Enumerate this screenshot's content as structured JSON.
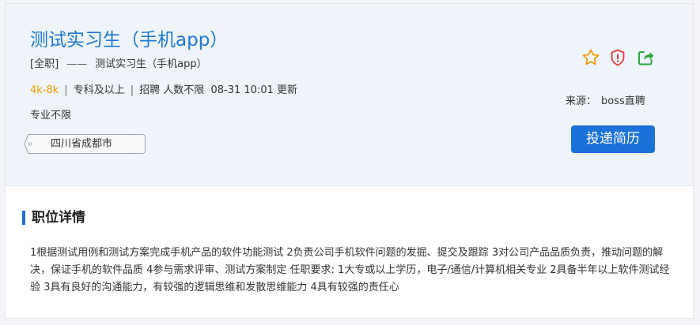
{
  "job": {
    "title": "测试实习生（手机app）",
    "type_tag": "[全职]",
    "separator": "——",
    "subtitle_name": "测试实习生（手机app）",
    "salary": "4k-8k",
    "education": "专科及以上",
    "recruit": "招聘 人数不限",
    "updated": "08-31 10:01 更新",
    "major": "专业不限",
    "location": "四川省成都市",
    "pipe": "|"
  },
  "source": {
    "label": "来源：",
    "value": "boss直聘"
  },
  "actions": {
    "apply_label": "投递简历",
    "icons": [
      "star-icon",
      "shield-icon",
      "share-icon"
    ]
  },
  "detail": {
    "section_title": "职位详情",
    "description": "1根据测试用例和测试方案完成手机产品的软件功能测试 2负责公司手机软件问题的发掘、提交及跟踪 3对公司产品品质负责，推动问题的解决，保证手机的软件品质 4参与需求评审、测试方案制定 任职要求: 1大专或以上学历，电子/通信/计算机相关专业 2具备半年以上软件测试经验 3具有良好的沟通能力，有较强的逻辑思维和发散思维能力 4具有较强的责任心"
  },
  "colors": {
    "accent": "#1b71d8",
    "title": "#1f78d1",
    "salary": "#f39800",
    "star": "#f39800",
    "shield": "#e23b3b",
    "share": "#2aa640"
  }
}
